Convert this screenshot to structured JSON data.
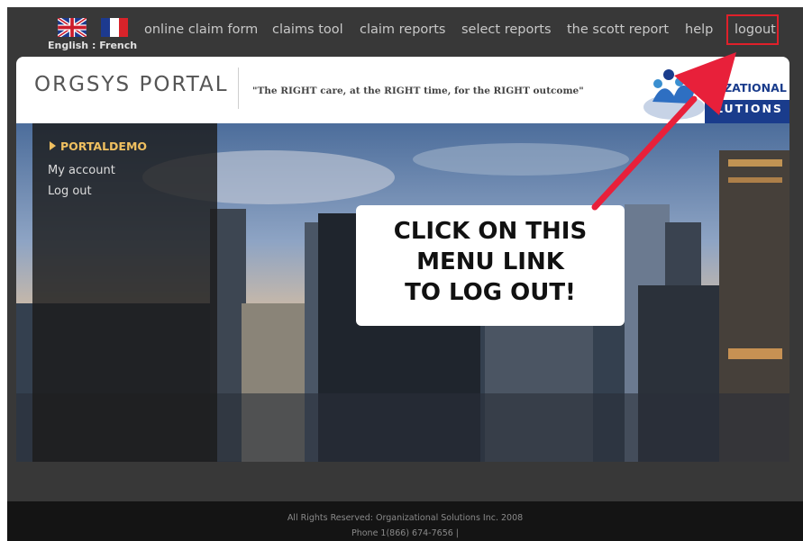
{
  "language": {
    "english": "English",
    "separator": " : ",
    "french": "French"
  },
  "nav": {
    "items": [
      "online claim form",
      "claims tool",
      "claim reports",
      "select reports",
      "the scott report",
      "help",
      "logout"
    ]
  },
  "header": {
    "title": "ORGSYS PORTAL",
    "tagline": "\"The RIGHT care, at the RIGHT time, for the RIGHT outcome\"",
    "logo_text_1": "NIZATIONAL",
    "logo_text_2": "LUTIONS"
  },
  "sidebar": {
    "heading": "PORTALDEMO",
    "links": [
      "My account",
      "Log out"
    ]
  },
  "callout": {
    "lines": [
      "CLICK ON THIS",
      "MENU LINK",
      "TO LOG OUT!"
    ]
  },
  "footer": {
    "copyright": "All Rights Reserved: Organizational Solutions Inc. 2008",
    "phone": "Phone 1(866) 674-7656 |"
  },
  "colors": {
    "background": "#383838",
    "nav_text": "#c8c8c8",
    "highlight_box": "#e0202a",
    "accent": "#f0c060",
    "footer": "#141414"
  }
}
